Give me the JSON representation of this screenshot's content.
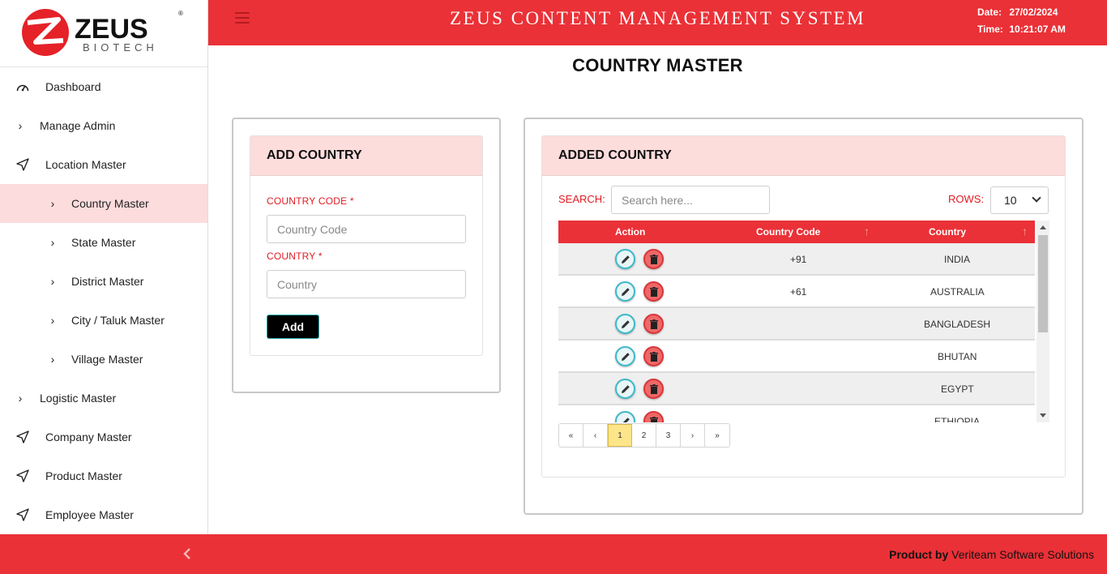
{
  "brand": {
    "name": "ZEUS",
    "sub": "BIOTECH"
  },
  "header": {
    "title": "ZEUS CONTENT MANAGEMENT SYSTEM",
    "date_label": "Date:",
    "date_value": "27/02/2024",
    "time_label": "Time:",
    "time_value": "10:21:07 AM"
  },
  "sidebar": {
    "items": [
      {
        "label": "Dashboard"
      },
      {
        "label": "Manage Admin"
      },
      {
        "label": "Location Master"
      },
      {
        "label": "Country Master"
      },
      {
        "label": "State Master"
      },
      {
        "label": "District Master"
      },
      {
        "label": "City / Taluk Master"
      },
      {
        "label": "Village Master"
      },
      {
        "label": "Logistic Master"
      },
      {
        "label": "Company Master"
      },
      {
        "label": "Product Master"
      },
      {
        "label": "Employee Master"
      }
    ]
  },
  "page": {
    "title": "COUNTRY MASTER"
  },
  "add_form": {
    "heading": "ADD COUNTRY",
    "code_label": "COUNTRY CODE *",
    "code_placeholder": "Country Code",
    "country_label": "COUNTRY *",
    "country_placeholder": "Country",
    "add_button": "Add"
  },
  "list": {
    "heading": "ADDED COUNTRY",
    "search_label": "SEARCH:",
    "search_placeholder": "Search here...",
    "rows_label": "ROWS:",
    "rows_value": "10",
    "columns": [
      "Action",
      "Country Code",
      "Country"
    ],
    "rows": [
      {
        "code": "+91",
        "country": "INDIA"
      },
      {
        "code": "+61",
        "country": "AUSTRALIA"
      },
      {
        "code": "",
        "country": "BANGLADESH"
      },
      {
        "code": "",
        "country": "BHUTAN"
      },
      {
        "code": "",
        "country": "EGYPT"
      },
      {
        "code": "",
        "country": "ETHIOPIA"
      }
    ],
    "pagination": [
      "«",
      "‹",
      "1",
      "2",
      "3",
      "›",
      "»"
    ],
    "current_page": "1"
  },
  "footer": {
    "prefix": "Product by",
    "company": "Veriteam Software Solutions"
  },
  "colors": {
    "accent": "#ea3137",
    "active_bg": "#fcdcdc",
    "card_head": "#fddcdc"
  }
}
